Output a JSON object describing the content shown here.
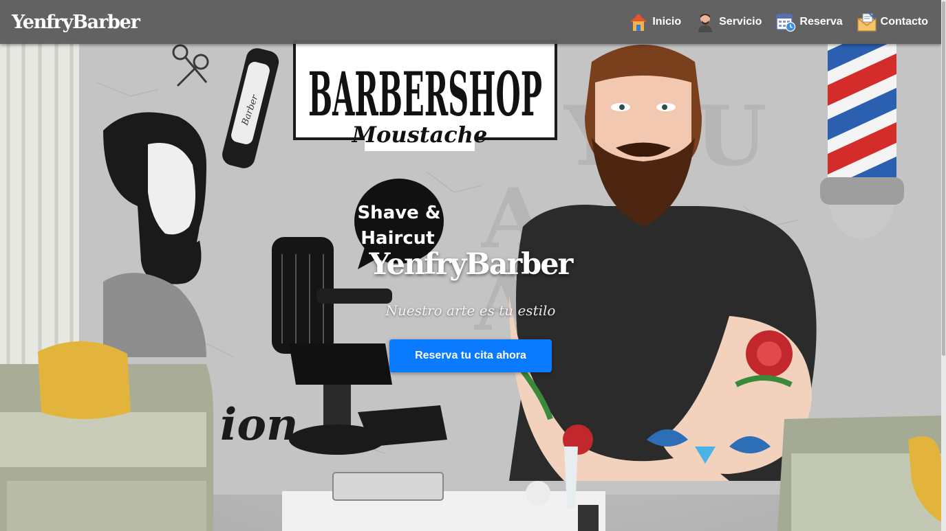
{
  "brand": "YenfryBarber",
  "nav": [
    {
      "label": "Inicio",
      "icon": "house-icon"
    },
    {
      "label": "Servicio",
      "icon": "barber-icon"
    },
    {
      "label": "Reserva",
      "icon": "calendar-icon"
    },
    {
      "label": "Contacto",
      "icon": "envelope-icon"
    }
  ],
  "hero": {
    "title": "YenfryBarber",
    "subtitle": "Nuestro arte es tu estilo",
    "cta_label": "Reserva tu cita ahora"
  },
  "mural": {
    "sign_main": "BARBERSHOP",
    "sign_script": "Moustache",
    "bubble_line1": "Shave &",
    "bubble_line2": "Haircut",
    "wall_text": "ion",
    "clipper_text": "Barber"
  },
  "colors": {
    "navbar": "#5f5f5f",
    "cta": "#0a7bff",
    "text": "#ffffff"
  }
}
